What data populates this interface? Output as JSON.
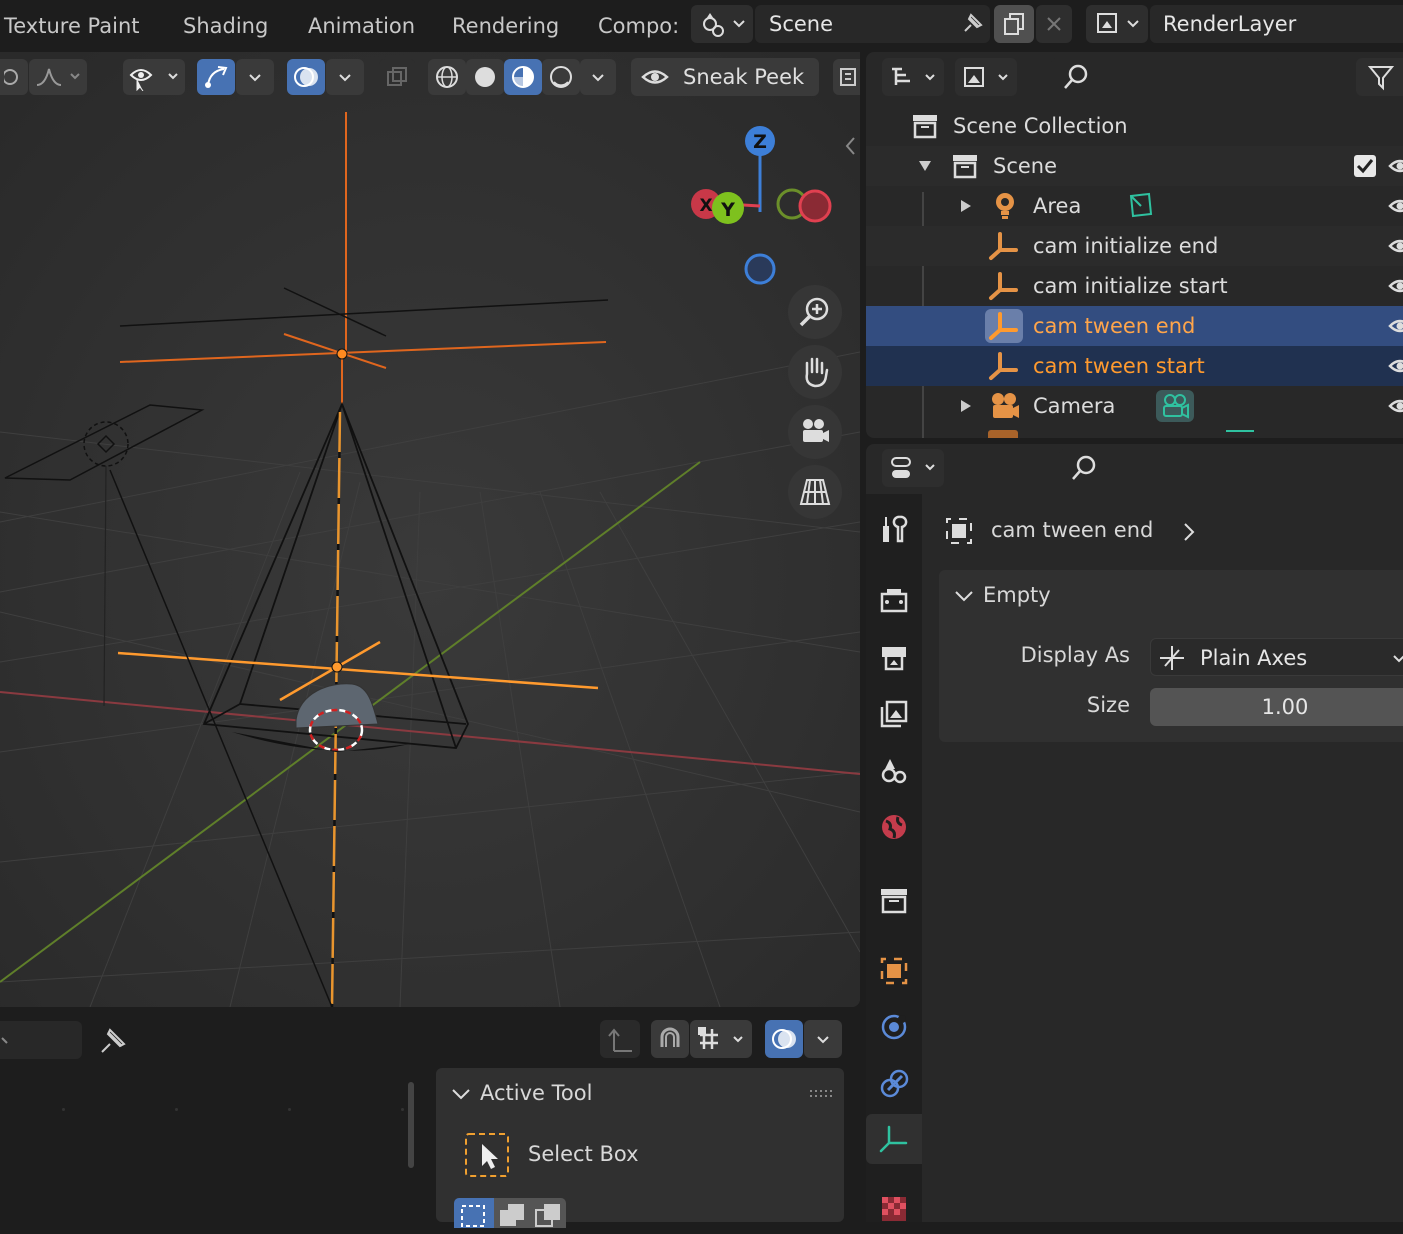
{
  "topbar": {
    "workspace_tabs": [
      "Texture Paint",
      "Shading",
      "Animation",
      "Rendering",
      "Compo:"
    ],
    "scene_name": "Scene",
    "render_layer": "RenderLayer"
  },
  "viewport": {
    "header": {
      "sneak_peek_label": "Sneak Peek"
    },
    "gizmo": {
      "z_label": "Z",
      "x_label": "X",
      "y_label": "Y"
    }
  },
  "outliner": {
    "root": "Scene Collection",
    "scene": "Scene",
    "items": [
      {
        "name": "Area",
        "state": "normal"
      },
      {
        "name": "cam initialize end",
        "state": "normal"
      },
      {
        "name": "cam initialize start",
        "state": "normal"
      },
      {
        "name": "cam tween end",
        "state": "active"
      },
      {
        "name": "cam tween start",
        "state": "selected"
      },
      {
        "name": "Camera",
        "state": "normal"
      }
    ]
  },
  "properties": {
    "object_name": "cam tween end",
    "panel_title": "Empty",
    "display_as_label": "Display As",
    "display_as_value": "Plain Axes",
    "size_label": "Size",
    "size_value": "1.00"
  },
  "tool_panel": {
    "title": "Active Tool",
    "tool_name": "Select Box"
  },
  "colors": {
    "accent_blue": "#4772b3",
    "selected_orange": "#ff9a2e",
    "empty_icon_orange": "#e59346",
    "axis_x_red": "#e04050",
    "axis_y_green": "#7ec11e",
    "axis_z_blue": "#3d7fd8"
  }
}
